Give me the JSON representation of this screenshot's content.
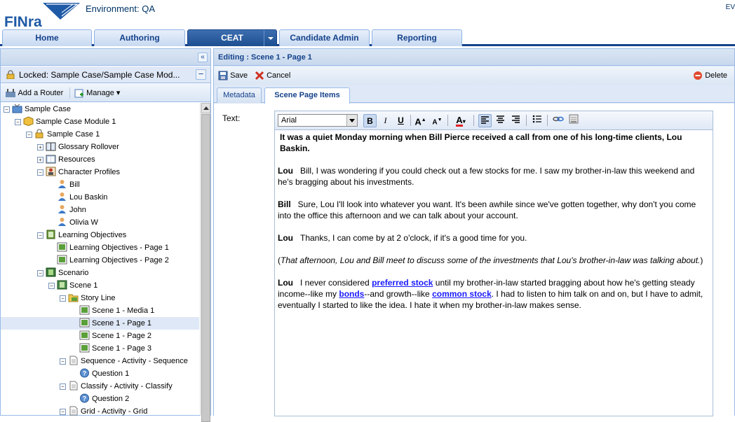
{
  "header": {
    "environment": "Environment: QA",
    "user_initials": "EV"
  },
  "tabs": [
    "Home",
    "Authoring",
    "CEAT",
    "Candidate Admin",
    "Reporting"
  ],
  "left": {
    "lock_text": "Locked: Sample Case/Sample Case Mod...",
    "add_router": "Add a Router",
    "manage": "Manage",
    "tree": [
      {
        "label": "Sample Case"
      },
      {
        "label": "Sample Case Module 1"
      },
      {
        "label": "Sample Case 1"
      },
      {
        "label": "Glossary Rollover"
      },
      {
        "label": "Resources"
      },
      {
        "label": "Character Profiles"
      },
      {
        "label": "Bill"
      },
      {
        "label": "Lou Baskin"
      },
      {
        "label": "John"
      },
      {
        "label": "Olivia W"
      },
      {
        "label": "Learning Objectives"
      },
      {
        "label": "Learning Objectives - Page 1"
      },
      {
        "label": "Learning Objectives - Page 2"
      },
      {
        "label": "Scenario"
      },
      {
        "label": "Scene 1"
      },
      {
        "label": "Story Line"
      },
      {
        "label": "Scene 1 - Media 1"
      },
      {
        "label": "Scene 1 - Page 1"
      },
      {
        "label": "Scene 1 - Page 2"
      },
      {
        "label": "Scene 1 - Page 3"
      },
      {
        "label": "Sequence - Activity - Sequence"
      },
      {
        "label": "Question 1"
      },
      {
        "label": "Classify - Activity - Classify"
      },
      {
        "label": "Question 2"
      },
      {
        "label": "Grid - Activity - Grid"
      }
    ]
  },
  "right": {
    "title": "Editing : Scene 1 - Page 1",
    "save": "Save",
    "cancel": "Cancel",
    "delete": "Delete",
    "tabs": [
      "Metadata",
      "Scene Page Items"
    ],
    "text_label": "Text:",
    "font": "Arial",
    "content": {
      "intro": "It was a quiet Monday morning when Bill Pierce received a call from one of his long-time clients, Lou Baskin.",
      "l1_speaker": "Lou",
      "l1_text": "Bill, I was wondering if you could check out a few stocks for me.  I saw my brother-in-law this weekend and he's bragging about his investments.",
      "l2_speaker": "Bill",
      "l2_text": "Sure, Lou I'll look into whatever you want. It's been awhile since we've gotten together, why don't you come into the office this afternoon and we can talk about your account.",
      "l3_speaker": "Lou",
      "l3_text": "Thanks, I can come by at 2 o'clock, if it's a good time for you.",
      "aside_open": "(",
      "aside": "That afternoon, Lou and Bill meet to discuss some of the investments that Lou's brother-in-law was talking about.",
      "aside_close": ")",
      "l4_speaker": "Lou",
      "l4_a": "I never considered ",
      "l4_link1": "preferred stock",
      "l4_b": " until my brother-in-law started bragging about how he's getting steady income--like my ",
      "l4_link2": "bonds",
      "l4_c": "--and growth--like ",
      "l4_link3": "common stock",
      "l4_d": ".  I had to listen to him talk on and on, but I have to admit, eventually I started to like the idea.  I hate it when my brother-in-law makes sense."
    }
  },
  "colors": {
    "accent": "#15428b",
    "link": "#1a1aff"
  }
}
